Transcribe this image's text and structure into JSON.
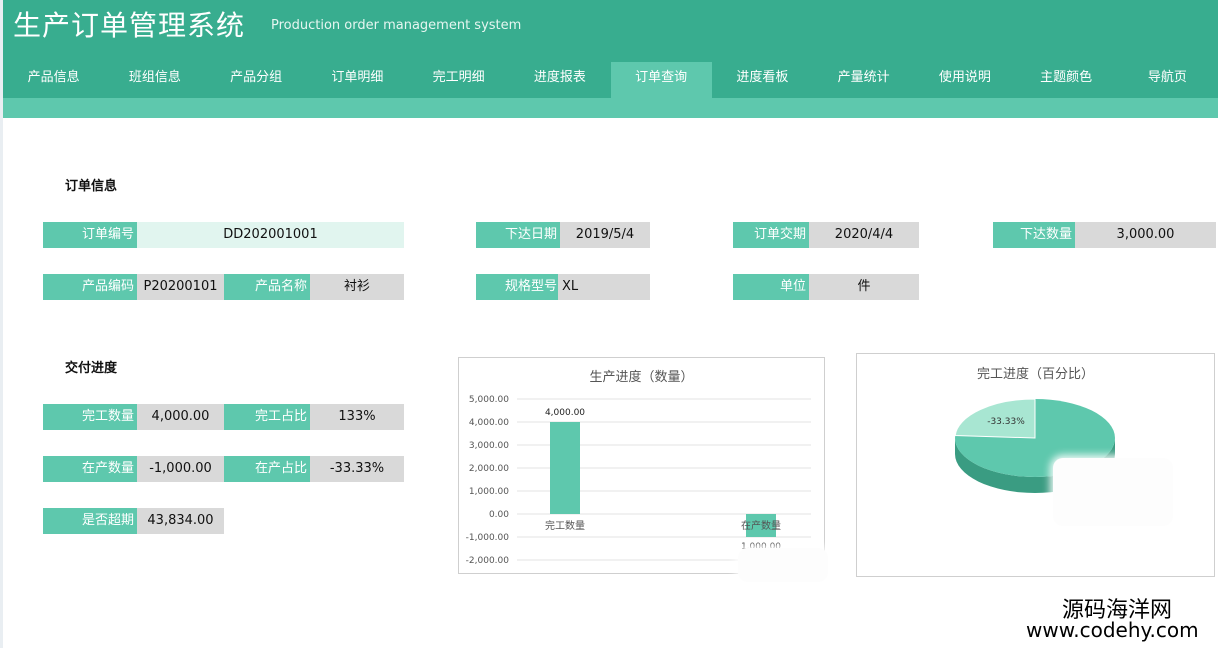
{
  "header": {
    "title": "生产订单管理系统",
    "subtitle": "Production order management system"
  },
  "nav": {
    "items": [
      "产品信息",
      "班组信息",
      "产品分组",
      "订单明细",
      "完工明细",
      "进度报表",
      "订单查询",
      "进度看板",
      "产量统计",
      "使用说明",
      "主题颜色",
      "导航页"
    ],
    "active": "订单查询"
  },
  "order_info": {
    "section_title": "订单信息",
    "order_no_label": "订单编号",
    "order_no": "DD202001001",
    "issue_date_label": "下达日期",
    "issue_date": "2019/5/4",
    "delivery_date_label": "订单交期",
    "delivery_date": "2020/4/4",
    "issue_qty_label": "下达数量",
    "issue_qty": "3,000.00",
    "product_code_label": "产品编码",
    "product_code": "P20200101",
    "product_name_label": "产品名称",
    "product_name": "衬衫",
    "spec_label": "规格型号",
    "spec": "XL",
    "unit_label": "单位",
    "unit": "件"
  },
  "delivery_progress": {
    "section_title": "交付进度",
    "done_qty_label": "完工数量",
    "done_qty": "4,000.00",
    "done_ratio_label": "完工占比",
    "done_ratio": "133%",
    "wip_qty_label": "在产数量",
    "wip_qty": "-1,000.00",
    "wip_ratio_label": "在产占比",
    "wip_ratio": "-33.33%",
    "overdue_label": "是否超期",
    "overdue": "43,834.00"
  },
  "chart_data": [
    {
      "type": "bar",
      "title": "生产进度（数量）",
      "categories": [
        "完工数量",
        "在产数量"
      ],
      "values": [
        4000,
        -1000
      ],
      "data_labels": [
        "4,000.00",
        "1,000.00"
      ],
      "ylim": [
        -2000,
        5000
      ],
      "yticks": [
        "5,000.00",
        "4,000.00",
        "3,000.00",
        "2,000.00",
        "1,000.00",
        "0.00",
        "-1,000.00",
        "-2,000.00"
      ],
      "grid": true,
      "color": "#5ec8ad"
    },
    {
      "type": "pie",
      "title": "完工进度（百分比）",
      "slices": [
        {
          "label": "-33.33%",
          "value": -33.33,
          "color": "#a8e6d2"
        },
        {
          "label": "",
          "value": 133,
          "color": "#5ec8ad"
        }
      ],
      "style": "3d"
    }
  ],
  "watermark": {
    "line1": "源码海洋网",
    "line2": "www.codehy.com"
  }
}
